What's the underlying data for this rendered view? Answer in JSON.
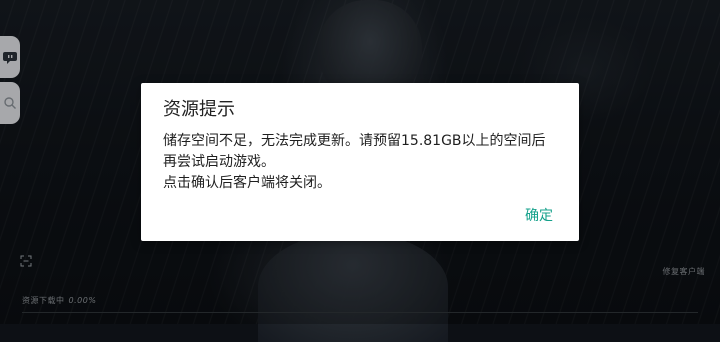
{
  "dialog": {
    "title": "资源提示",
    "message_lines": [
      "储存空间不足，无法完成更新。请预留15.81GB以上的空间后",
      "再尝试启动游戏。",
      "点击确认后客户端将关闭。"
    ],
    "confirm_label": "确定"
  },
  "download": {
    "label": "资源下载中",
    "percent_text": "0.00%",
    "progress": 0.0
  },
  "repair_label": "修复客户端",
  "colors": {
    "confirm": "#15a18b",
    "dialog_bg": "#ffffff",
    "side_button_bg": "#dfe1e4"
  },
  "icons": {
    "side_button_1": "chat-bubble-icon",
    "side_button_2": "search-icon",
    "capture": "screen-capture-icon"
  }
}
